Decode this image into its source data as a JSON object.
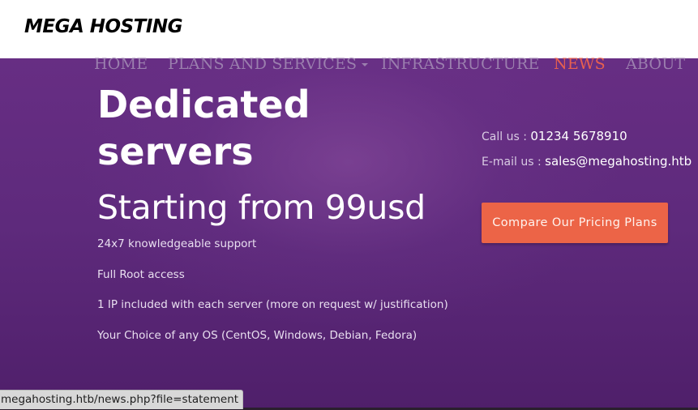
{
  "header": {
    "logo_text": "MEGA HOSTING"
  },
  "nav": {
    "items": [
      {
        "label": "HOME",
        "active": false
      },
      {
        "label": "PLANS AND SERVICES",
        "active": false,
        "has_dropdown": true
      },
      {
        "label": "INFRASTRUCTURE",
        "active": false
      },
      {
        "label": "NEWS",
        "active": true
      },
      {
        "label": "ABOUT",
        "active": false
      }
    ]
  },
  "hero": {
    "headline_line1": "Dedicated",
    "headline_line2": "servers",
    "subheadline": "Starting from 99usd",
    "features": [
      "24x7 knowledgeable support",
      "Full Root access",
      "1 IP included with each server (more on request w/ justification)",
      "Your Choice of any OS (CentOS, Windows, Debian, Fedora)"
    ]
  },
  "contact": {
    "phone_label": "Call us : ",
    "phone": "01234 5678910",
    "email_label": "E-mail us : ",
    "email": "sales@megahosting.htb"
  },
  "cta": {
    "label": "Compare Our Pricing Plans"
  },
  "status_bar": {
    "url": "megahosting.htb/news.php?file=statement"
  },
  "colors": {
    "background": "#5e2a7c",
    "nav_text": "#9b7fae",
    "nav_active": "#e8604f",
    "cta_button": "#ec6447"
  }
}
